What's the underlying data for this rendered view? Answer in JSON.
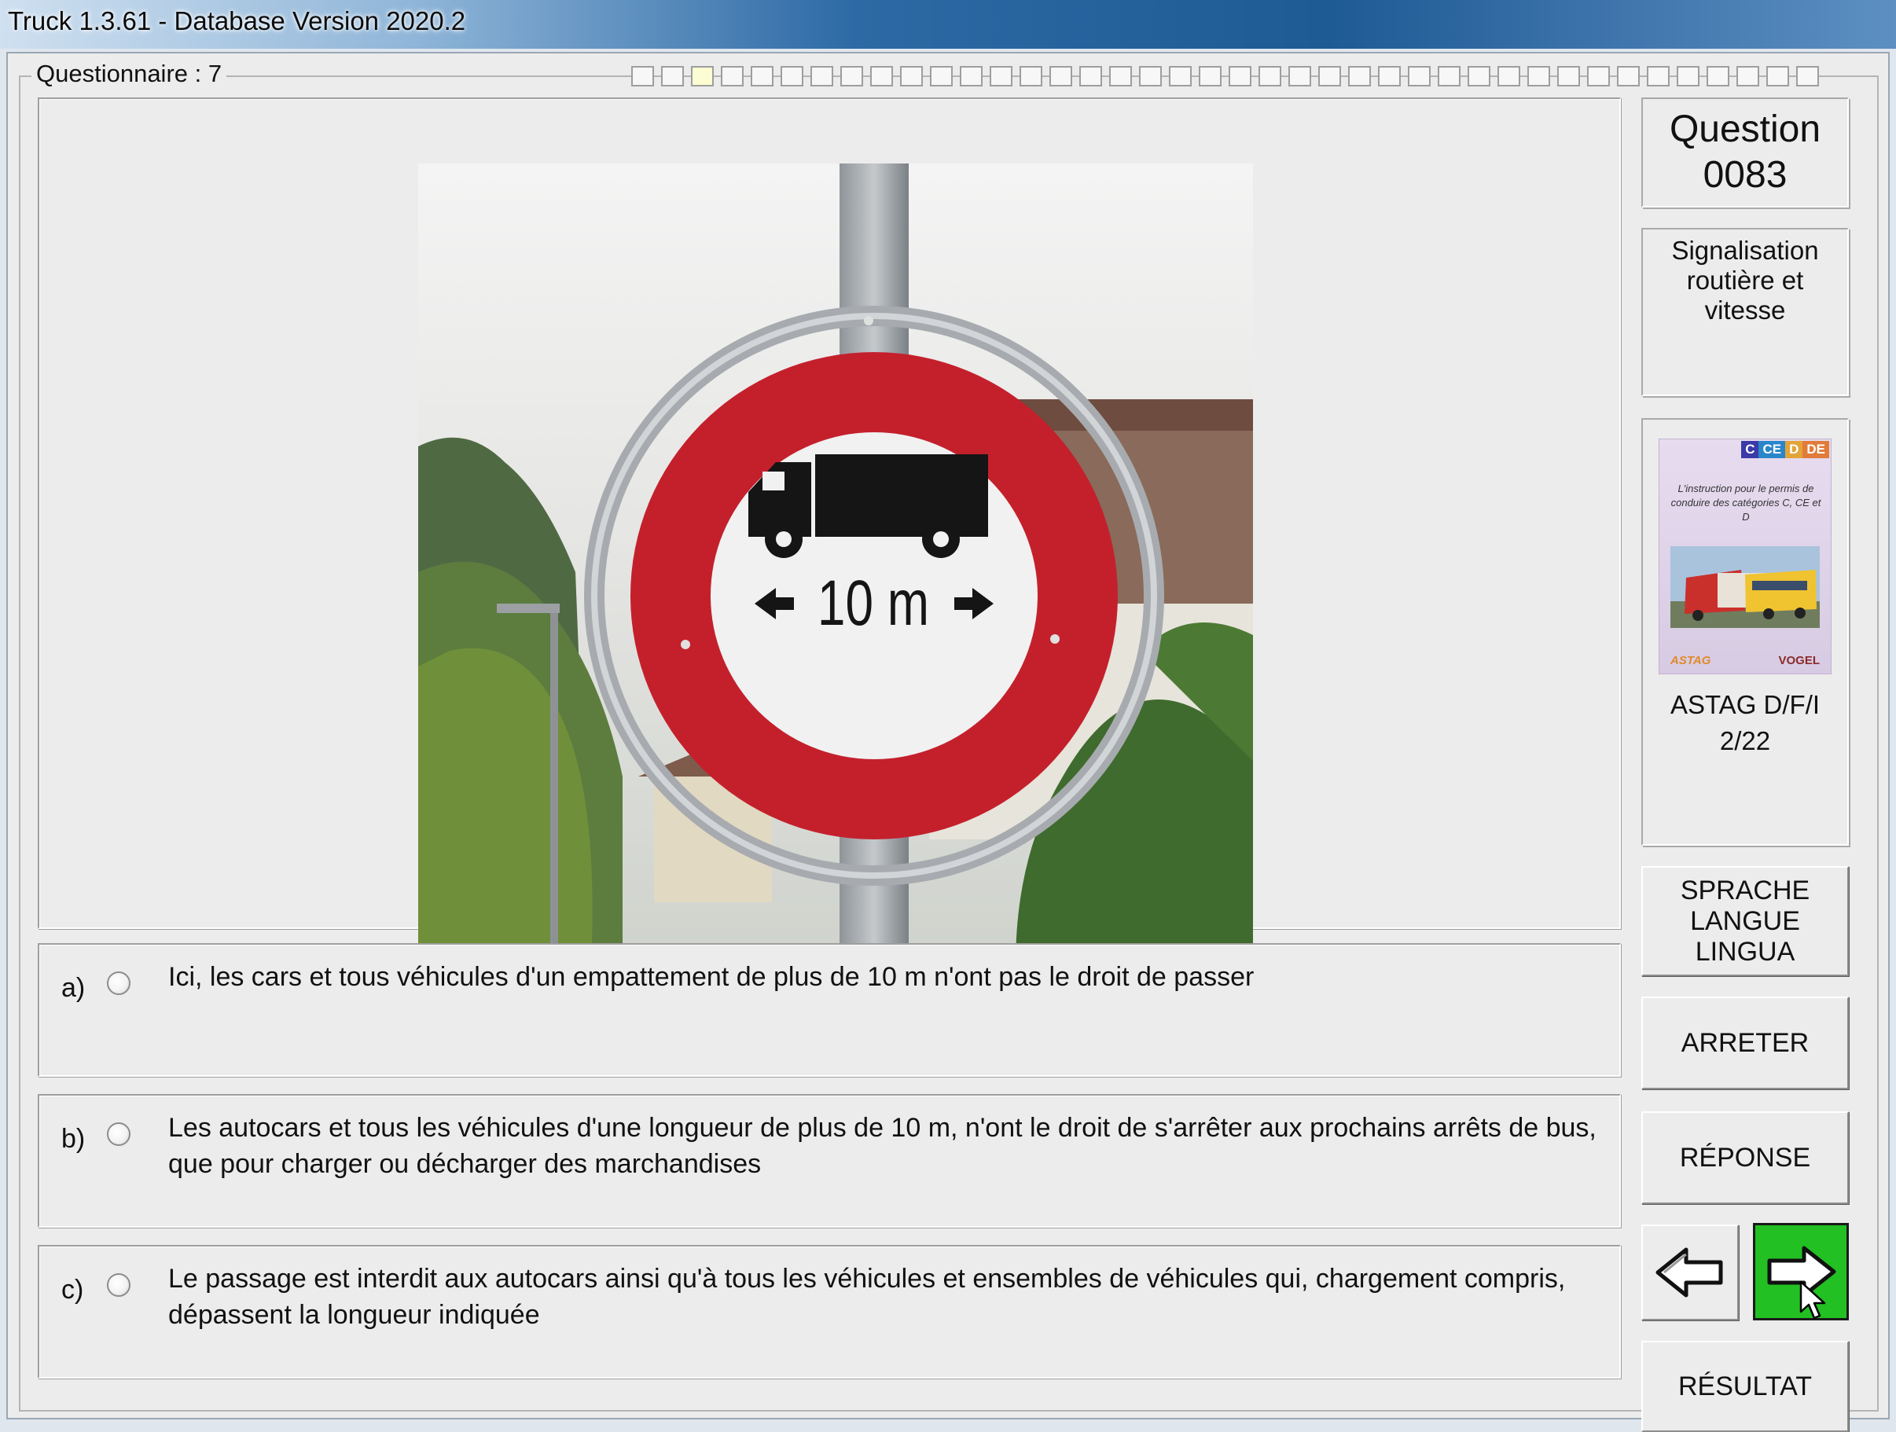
{
  "window": {
    "title": "Truck 1.3.61 - Database Version 2020.2"
  },
  "questionnaire": {
    "label": "Questionnaire : 7"
  },
  "question": {
    "label": "Question\n0083",
    "category": "Signalisation\nroutière et vitesse"
  },
  "sign": {
    "length_text": "10 m"
  },
  "answers": [
    {
      "letter": "a)",
      "text": "Ici, les cars et tous véhicules d'un empattement de plus de 10 m n'ont pas le droit de passer"
    },
    {
      "letter": "b)",
      "text": "Les autocars et tous les véhicules d'une longueur de plus de 10 m, n'ont le droit de s'arrêter aux prochains arrêts de bus, que pour charger ou décharger des marchandises"
    },
    {
      "letter": "c)",
      "text": "Le passage est interdit aux autocars ainsi qu'à tous les véhicules et ensembles de véhicules qui, chargement compris, dépassent la longueur indiquée"
    }
  ],
  "book": {
    "badges": [
      "C",
      "CE",
      "D",
      "DE"
    ],
    "badge_colors": [
      "#3a3aa8",
      "#2a86c9",
      "#e3a43a",
      "#e07b39"
    ],
    "cover_text": "L'instruction pour le permis de conduire des catégories C, CE et D",
    "logo_left": "ASTAG",
    "logo_right": "VOGEL",
    "title": "ASTAG D/F/I\n2/22"
  },
  "buttons": {
    "language": "SPRACHE\nLANGUE\nLINGUA",
    "stop": "ARRETER",
    "answer": "RÉPONSE",
    "result": "RÉSULTAT",
    "prev_icon": "arrow-left-icon",
    "next_icon": "arrow-right-icon"
  },
  "colors": {
    "sign_red": "#c4202c",
    "next_button_green": "#22c022"
  }
}
